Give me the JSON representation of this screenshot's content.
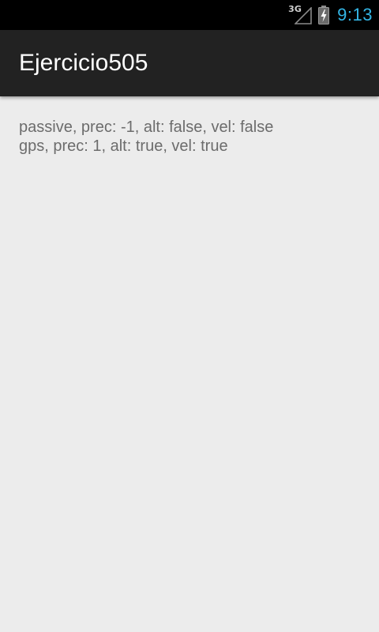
{
  "status_bar": {
    "network_type": "3G",
    "time": "9:13",
    "clock_color": "#33b5e5"
  },
  "action_bar": {
    "title": "Ejercicio505"
  },
  "content": {
    "lines": [
      "passive, prec: -1, alt: false, vel: false",
      "gps, prec: 1, alt: true, vel: true"
    ]
  }
}
